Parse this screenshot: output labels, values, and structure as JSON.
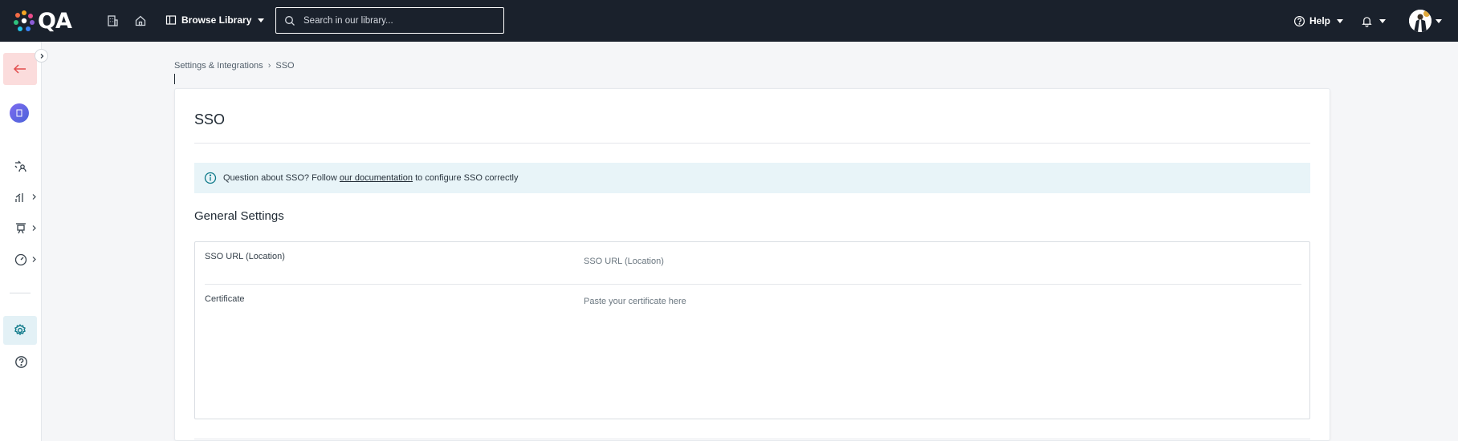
{
  "brand": {
    "name": "QA"
  },
  "topbar": {
    "browse_label": "Browse Library",
    "search_placeholder": "Search in our library...",
    "help_label": "Help"
  },
  "breadcrumb": {
    "parent": "Settings & Integrations",
    "current": "SSO"
  },
  "page": {
    "title": "SSO",
    "info": {
      "prefix": "Question about SSO? Follow ",
      "link": "our documentation",
      "suffix": " to configure SSO correctly"
    },
    "section_title": "General Settings",
    "fields": {
      "sso_url": {
        "label": "SSO URL (Location)",
        "placeholder": "SSO URL (Location)",
        "value": ""
      },
      "certificate": {
        "label": "Certificate",
        "placeholder": "Paste your certificate here",
        "value": ""
      }
    }
  },
  "colors": {
    "topbar": "#1a212c",
    "back_button_bg": "#fbdcdc",
    "back_arrow": "#e24c4c",
    "active_sidebar": "#e3f1f6",
    "info_banner": "#e8f4f8",
    "accent_teal": "#0f7a8a"
  },
  "icons": {
    "logo": "qa-logo-icon",
    "building": "building-icon",
    "home": "home-icon",
    "browse": "library-panel-icon",
    "search": "search-icon",
    "help": "help-circle-icon",
    "bell": "bell-icon",
    "back": "arrow-left-icon",
    "info": "info-icon"
  }
}
